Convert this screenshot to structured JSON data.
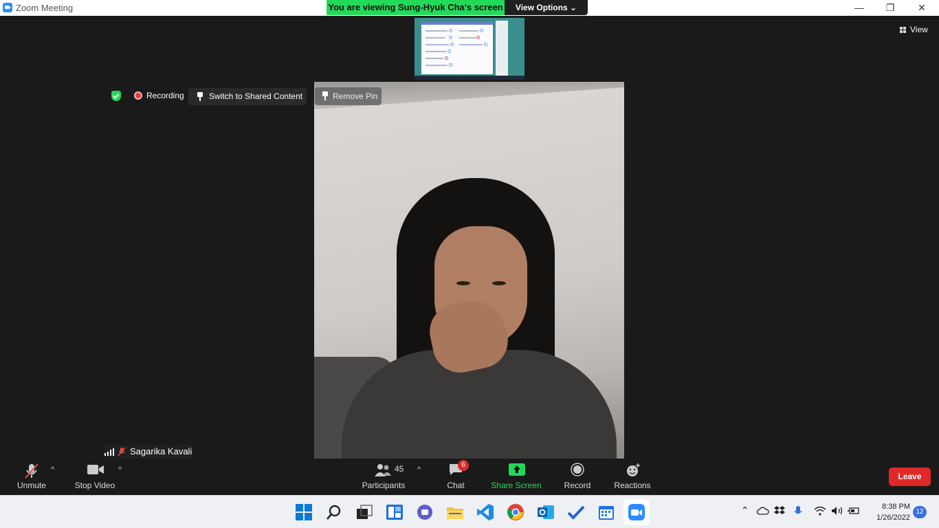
{
  "window": {
    "title": "Zoom Meeting",
    "minimize": "—",
    "restore": "❐",
    "close": "✕"
  },
  "banner": {
    "viewing_text": "You are viewing Sung-Hyuk Cha's screen",
    "view_options_label": "View Options ⌄"
  },
  "view_button": {
    "label": "View"
  },
  "status": {
    "recording_label": "Recording",
    "switch_label": "Switch to Shared Content",
    "remove_pin_label": "Remove Pin"
  },
  "participant": {
    "name": "Sagarika Kavali"
  },
  "toolbar": {
    "unmute_label": "Unmute",
    "stop_video_label": "Stop Video",
    "participants_label": "Participants",
    "participants_count": "45",
    "chat_label": "Chat",
    "chat_badge": "6",
    "share_label": "Share Screen",
    "record_label": "Record",
    "reactions_label": "Reactions",
    "leave_label": "Leave",
    "caret": "^"
  },
  "taskbar": {
    "time": "8:38 PM",
    "date": "1/26/2022",
    "notification_count": "12",
    "icons": [
      "windows-start-icon",
      "search-icon",
      "task-view-icon",
      "widgets-icon",
      "teams-chat-icon",
      "file-explorer-icon",
      "vscode-icon",
      "chrome-icon",
      "outlook-icon",
      "todo-icon",
      "calendar-icon",
      "zoom-icon"
    ]
  },
  "colors": {
    "accent_green": "#23d959",
    "leave_red": "#e02828",
    "zoom_blue": "#2d8cff"
  }
}
